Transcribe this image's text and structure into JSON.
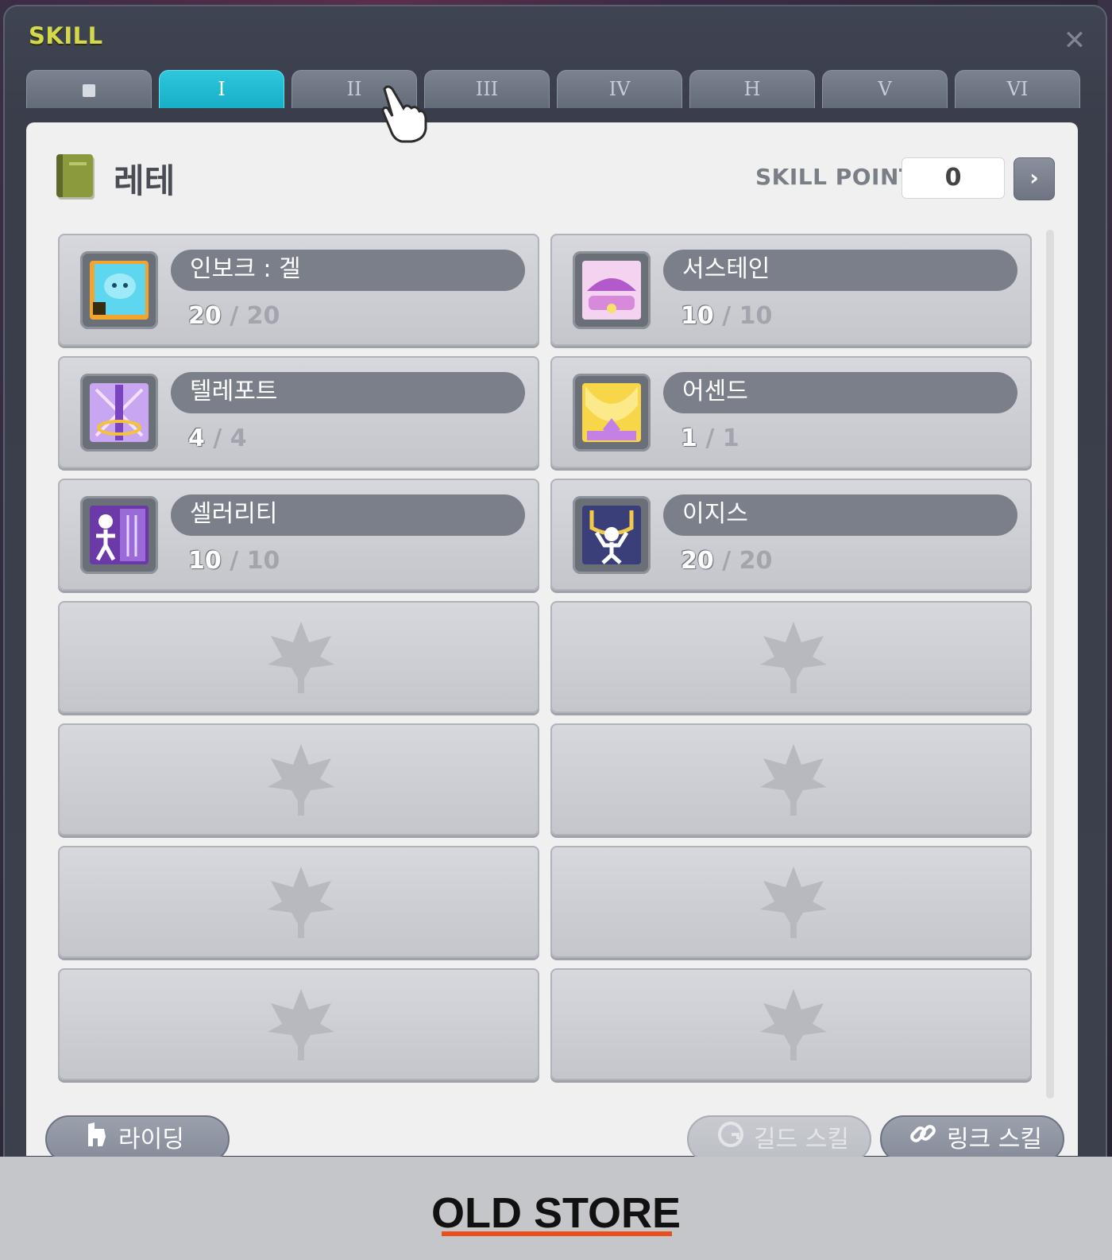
{
  "window": {
    "title": "SKILL",
    "close_glyph": "✕"
  },
  "tabs": [
    {
      "label": "",
      "icon": "square-icon",
      "active": false
    },
    {
      "label": "I",
      "active": true
    },
    {
      "label": "II",
      "active": false
    },
    {
      "label": "III",
      "active": false
    },
    {
      "label": "IV",
      "active": false
    },
    {
      "label": "H",
      "active": false
    },
    {
      "label": "V",
      "active": false
    },
    {
      "label": "VI",
      "active": false
    }
  ],
  "header": {
    "job_name": "레테",
    "skill_point_label": "SKILL POINT",
    "skill_point_value": "0",
    "next_glyph": "›"
  },
  "skills": [
    {
      "name": "인보크 : 겔",
      "current": "20",
      "max": "/ 20",
      "icon": "invoke-gel-icon",
      "colors": [
        "#f2a52a",
        "#5fd6f0"
      ]
    },
    {
      "name": "서스테인",
      "current": "10",
      "max": "/ 10",
      "icon": "sustain-icon",
      "colors": [
        "#f4d3f1",
        "#b25ac9"
      ]
    },
    {
      "name": "텔레포트",
      "current": "4",
      "max": "/ 4",
      "icon": "teleport-icon",
      "colors": [
        "#c9a6f2",
        "#f4c33a"
      ]
    },
    {
      "name": "어센드",
      "current": "1",
      "max": "/ 1",
      "icon": "ascend-icon",
      "colors": [
        "#f7d64a",
        "#c580e6"
      ]
    },
    {
      "name": "셀러리티",
      "current": "10",
      "max": "/ 10",
      "icon": "celerity-icon",
      "colors": [
        "#6c3aa8",
        "#ffffff"
      ]
    },
    {
      "name": "이지스",
      "current": "20",
      "max": "/ 20",
      "icon": "aegis-icon",
      "colors": [
        "#3a3f7a",
        "#f0c84a"
      ]
    }
  ],
  "empty_slot_icon": "maple-leaf-icon",
  "bottom_buttons": {
    "riding": "라이딩",
    "guild_skill": "길드 스킬",
    "link_skill": "링크 스킬"
  },
  "footer": {
    "store_name": "OLD STORE"
  }
}
